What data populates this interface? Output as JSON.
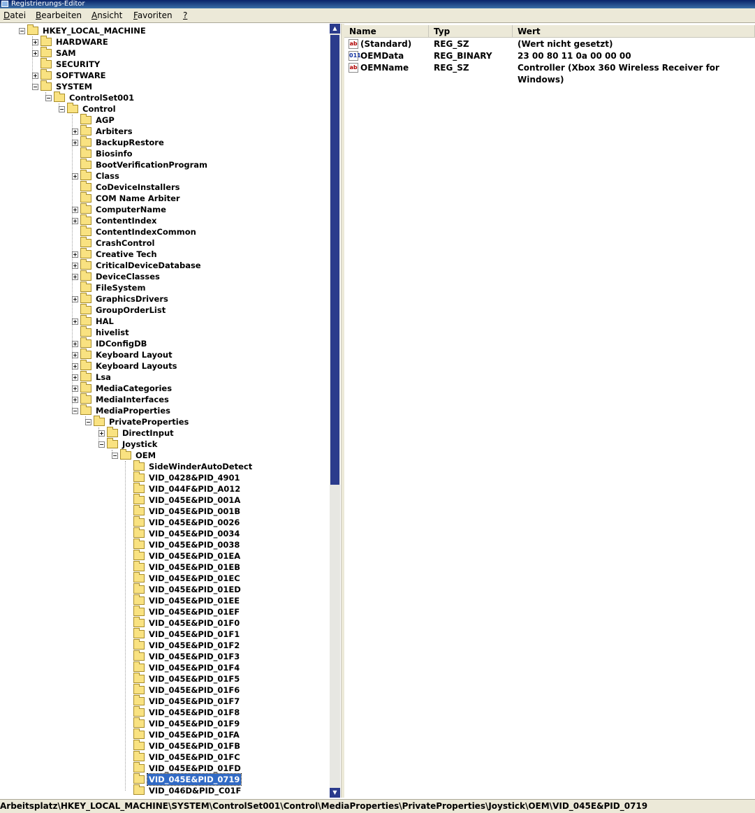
{
  "window": {
    "title": "Registrierungs-Editor"
  },
  "menu": [
    {
      "mnemonic": "D",
      "rest": "atei"
    },
    {
      "mnemonic": "B",
      "rest": "earbeiten"
    },
    {
      "mnemonic": "A",
      "rest": "nsicht"
    },
    {
      "mnemonic": "F",
      "rest": "avoriten"
    },
    {
      "mnemonic": "?",
      "rest": ""
    }
  ],
  "tree": [
    {
      "label": "HKEY_LOCAL_MACHINE",
      "level": 0,
      "exp": "minus"
    },
    {
      "label": "HARDWARE",
      "level": 1,
      "exp": "plus"
    },
    {
      "label": "SAM",
      "level": 1,
      "exp": "plus"
    },
    {
      "label": "SECURITY",
      "level": 1,
      "exp": "none"
    },
    {
      "label": "SOFTWARE",
      "level": 1,
      "exp": "plus"
    },
    {
      "label": "SYSTEM",
      "level": 1,
      "exp": "minus"
    },
    {
      "label": "ControlSet001",
      "level": 2,
      "exp": "minus"
    },
    {
      "label": "Control",
      "level": 3,
      "exp": "minus"
    },
    {
      "label": "AGP",
      "level": 4,
      "exp": "none"
    },
    {
      "label": "Arbiters",
      "level": 4,
      "exp": "plus"
    },
    {
      "label": "BackupRestore",
      "level": 4,
      "exp": "plus"
    },
    {
      "label": "Biosinfo",
      "level": 4,
      "exp": "none"
    },
    {
      "label": "BootVerificationProgram",
      "level": 4,
      "exp": "none"
    },
    {
      "label": "Class",
      "level": 4,
      "exp": "plus"
    },
    {
      "label": "CoDeviceInstallers",
      "level": 4,
      "exp": "none"
    },
    {
      "label": "COM Name Arbiter",
      "level": 4,
      "exp": "none"
    },
    {
      "label": "ComputerName",
      "level": 4,
      "exp": "plus"
    },
    {
      "label": "ContentIndex",
      "level": 4,
      "exp": "plus"
    },
    {
      "label": "ContentIndexCommon",
      "level": 4,
      "exp": "none"
    },
    {
      "label": "CrashControl",
      "level": 4,
      "exp": "none"
    },
    {
      "label": "Creative Tech",
      "level": 4,
      "exp": "plus"
    },
    {
      "label": "CriticalDeviceDatabase",
      "level": 4,
      "exp": "plus"
    },
    {
      "label": "DeviceClasses",
      "level": 4,
      "exp": "plus"
    },
    {
      "label": "FileSystem",
      "level": 4,
      "exp": "none"
    },
    {
      "label": "GraphicsDrivers",
      "level": 4,
      "exp": "plus"
    },
    {
      "label": "GroupOrderList",
      "level": 4,
      "exp": "none"
    },
    {
      "label": "HAL",
      "level": 4,
      "exp": "plus"
    },
    {
      "label": "hivelist",
      "level": 4,
      "exp": "none"
    },
    {
      "label": "IDConfigDB",
      "level": 4,
      "exp": "plus"
    },
    {
      "label": "Keyboard Layout",
      "level": 4,
      "exp": "plus"
    },
    {
      "label": "Keyboard Layouts",
      "level": 4,
      "exp": "plus"
    },
    {
      "label": "Lsa",
      "level": 4,
      "exp": "plus"
    },
    {
      "label": "MediaCategories",
      "level": 4,
      "exp": "plus"
    },
    {
      "label": "MediaInterfaces",
      "level": 4,
      "exp": "plus"
    },
    {
      "label": "MediaProperties",
      "level": 4,
      "exp": "minus"
    },
    {
      "label": "PrivateProperties",
      "level": 5,
      "exp": "minus"
    },
    {
      "label": "DirectInput",
      "level": 6,
      "exp": "plus"
    },
    {
      "label": "Joystick",
      "level": 6,
      "exp": "minus"
    },
    {
      "label": "OEM",
      "level": 7,
      "exp": "minus"
    },
    {
      "label": "SideWinderAutoDetect",
      "level": 8,
      "exp": "none"
    },
    {
      "label": "VID_0428&PID_4901",
      "level": 8,
      "exp": "none"
    },
    {
      "label": "VID_044F&PID_A012",
      "level": 8,
      "exp": "none"
    },
    {
      "label": "VID_045E&PID_001A",
      "level": 8,
      "exp": "none"
    },
    {
      "label": "VID_045E&PID_001B",
      "level": 8,
      "exp": "none"
    },
    {
      "label": "VID_045E&PID_0026",
      "level": 8,
      "exp": "none"
    },
    {
      "label": "VID_045E&PID_0034",
      "level": 8,
      "exp": "none"
    },
    {
      "label": "VID_045E&PID_0038",
      "level": 8,
      "exp": "none"
    },
    {
      "label": "VID_045E&PID_01EA",
      "level": 8,
      "exp": "none"
    },
    {
      "label": "VID_045E&PID_01EB",
      "level": 8,
      "exp": "none"
    },
    {
      "label": "VID_045E&PID_01EC",
      "level": 8,
      "exp": "none"
    },
    {
      "label": "VID_045E&PID_01ED",
      "level": 8,
      "exp": "none"
    },
    {
      "label": "VID_045E&PID_01EE",
      "level": 8,
      "exp": "none"
    },
    {
      "label": "VID_045E&PID_01EF",
      "level": 8,
      "exp": "none"
    },
    {
      "label": "VID_045E&PID_01F0",
      "level": 8,
      "exp": "none"
    },
    {
      "label": "VID_045E&PID_01F1",
      "level": 8,
      "exp": "none"
    },
    {
      "label": "VID_045E&PID_01F2",
      "level": 8,
      "exp": "none"
    },
    {
      "label": "VID_045E&PID_01F3",
      "level": 8,
      "exp": "none"
    },
    {
      "label": "VID_045E&PID_01F4",
      "level": 8,
      "exp": "none"
    },
    {
      "label": "VID_045E&PID_01F5",
      "level": 8,
      "exp": "none"
    },
    {
      "label": "VID_045E&PID_01F6",
      "level": 8,
      "exp": "none"
    },
    {
      "label": "VID_045E&PID_01F7",
      "level": 8,
      "exp": "none"
    },
    {
      "label": "VID_045E&PID_01F8",
      "level": 8,
      "exp": "none"
    },
    {
      "label": "VID_045E&PID_01F9",
      "level": 8,
      "exp": "none"
    },
    {
      "label": "VID_045E&PID_01FA",
      "level": 8,
      "exp": "none"
    },
    {
      "label": "VID_045E&PID_01FB",
      "level": 8,
      "exp": "none"
    },
    {
      "label": "VID_045E&PID_01FC",
      "level": 8,
      "exp": "none"
    },
    {
      "label": "VID_045E&PID_01FD",
      "level": 8,
      "exp": "none"
    },
    {
      "label": "VID_045E&PID_0719",
      "level": 8,
      "exp": "none",
      "selected": true
    },
    {
      "label": "VID_046D&PID_C01F",
      "level": 8,
      "exp": "none"
    }
  ],
  "values_header": {
    "name": "Name",
    "type": "Typ",
    "data": "Wert"
  },
  "values": [
    {
      "icon": "string-value-icon",
      "glyph": "ab",
      "name": "(Standard)",
      "type": "REG_SZ",
      "data": "(Wert nicht gesetzt)"
    },
    {
      "icon": "binary-value-icon",
      "glyph": "011",
      "name": "OEMData",
      "type": "REG_BINARY",
      "data": "23 00 80 11 0a 00 00 00"
    },
    {
      "icon": "string-value-icon",
      "glyph": "ab",
      "name": "OEMName",
      "type": "REG_SZ",
      "data": "Controller (Xbox 360 Wireless Receiver for Windows)"
    }
  ],
  "status": {
    "path": "Arbeitsplatz\\HKEY_LOCAL_MACHINE\\SYSTEM\\ControlSet001\\Control\\MediaProperties\\PrivateProperties\\Joystick\\OEM\\VID_045E&PID_0719"
  },
  "colors": {
    "selection": "#316ac5",
    "titlebar": "#0a246a",
    "scrollbar": "#2b3b8c",
    "folder": "#f9e281"
  }
}
